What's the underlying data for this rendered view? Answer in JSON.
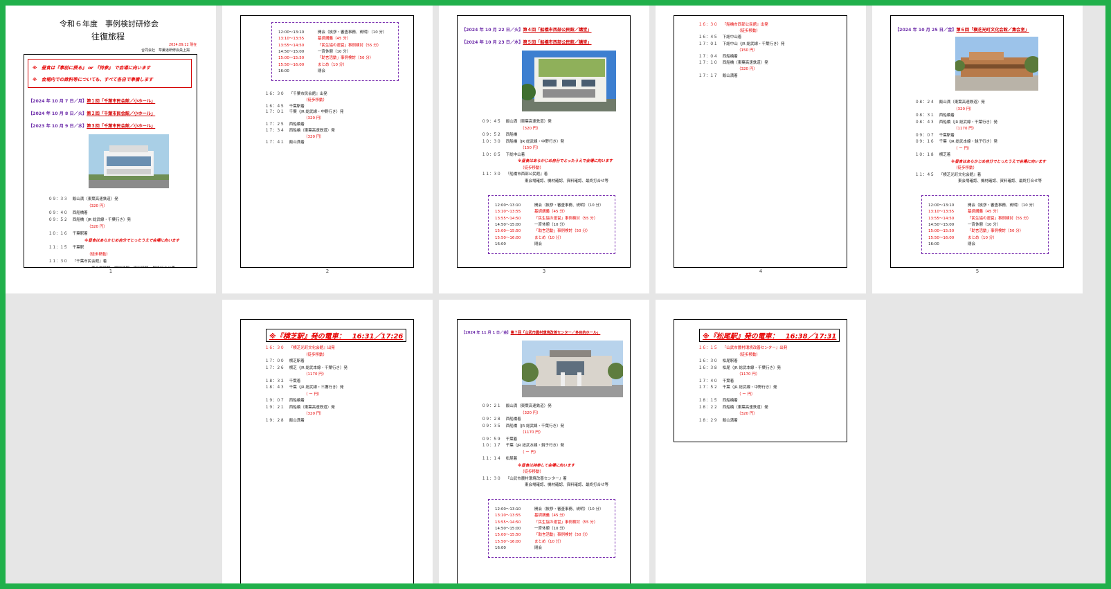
{
  "page1": {
    "title": "令和６年度　事例検討研修会",
    "subtitle": "往復旅程",
    "date": "2024.09.12 現在",
    "org": "合同会社　草薫道研修会員上掲",
    "notes": [
      "※　昼食は『事前に摂る』 or 『持参』 で会場に向います",
      "※　会場内での飲料等についても、すべて各自で準備します"
    ],
    "events": [
      {
        "date": "【2024 年 10 月  7 日／月】",
        "name": "第１回「千葉市民会館／小ホール」"
      },
      {
        "date": "【2024 年 10 月  8 日／火】",
        "name": "第２回「千葉市民会館／小ホール」"
      },
      {
        "date": "【2023 年 10 月  9 日／水】",
        "name": "第３回「千葉市民会館／小ホール」"
      }
    ],
    "lines": [
      {
        "t": "０９：３３　 飯山満（東葉高速鉄道）発",
        "red": false
      },
      {
        "t": "（320 円）",
        "red": true
      },
      {
        "t": "０９：４０　 西船橋着",
        "red": false
      },
      {
        "t": "０９：５２　 西船橋（JR 総武線・千葉行き）発",
        "red": false
      },
      {
        "t": "（320 円）",
        "red": true
      },
      {
        "t": "１０：１６　 千葉駅着",
        "red": false
      },
      {
        "t": "※昼食はあらかじめ自分でとったうえで会場に向います",
        "red": true
      },
      {
        "t": "１１：１５　 千葉駅",
        "red": false
      },
      {
        "t": "（徒歩移動）",
        "red": true
      },
      {
        "t": "１１：３０　 『千葉市民会館』着",
        "red": false
      },
      {
        "t": "東会場確認、機材確認、資料確認、最終打合せ等",
        "red": false
      }
    ],
    "num": "1"
  },
  "schedule": [
    {
      "time": "12:00〜13:10",
      "text": "開会（挨拶・審査事務、説明）（10 分）",
      "red": false
    },
    {
      "time": "13:10〜13:55",
      "text": "基調講義（45 分）",
      "red": true
    },
    {
      "time": "13:55〜14:50",
      "text": "「民生協の運営」事例検討（55 分）",
      "red": true
    },
    {
      "time": "14:50〜15:00",
      "text": "一斉休憩（10 分）",
      "red": false
    },
    {
      "time": "15:00〜15:50",
      "text": "「助言活動」事例検討（50 分）",
      "red": true
    },
    {
      "time": "15:50〜16:00",
      "text": "まとめ（10 分）",
      "red": true
    },
    {
      "time": "16:00",
      "text": "閉会",
      "red": false
    }
  ],
  "page2": {
    "lines": [
      {
        "t": "１６：３０　 『千葉市民会館』出発",
        "red": false
      },
      {
        "t": "（徒歩移動）",
        "red": true
      },
      {
        "t": "１６：４５　 千葉駅着",
        "red": false
      },
      {
        "t": "１７：０１　 千葉（JR 総武線・中野行き）発",
        "red": false
      },
      {
        "t": "（320 円）",
        "red": true
      },
      {
        "t": "１７：２５　 西船橋着",
        "red": false
      },
      {
        "t": "１７：３４　 西船橋（東葉高速鉄道）発",
        "red": false
      },
      {
        "t": "（320 円）",
        "red": true
      },
      {
        "t": "１７：４１　 飯山満着",
        "red": false
      }
    ],
    "num": "2"
  },
  "page3": {
    "events": [
      {
        "date": "【2024 年 10 月 22 日／火】",
        "name": "第４回「船橋市西部公民館／講堂」"
      },
      {
        "date": "【2024 年 10 月 23 日／水】",
        "name": "第５回「船橋市西部公民館／講堂」"
      }
    ],
    "lines": [
      {
        "t": "０９：４５　 飯山満（東葉高速鉄道）発",
        "red": false
      },
      {
        "t": "（320 円）",
        "red": true
      },
      {
        "t": "０９：５２　 西船橋",
        "red": false
      },
      {
        "t": "１０：３０　 西船橋（JR 総武線・中野行き）発",
        "red": false
      },
      {
        "t": "（150 円）",
        "red": true
      },
      {
        "t": "１０：０５　 下総中山着",
        "red": false
      },
      {
        "t": "※昼食はあらかじめ自分でとったうえで会場に向います",
        "red": true
      },
      {
        "t": "（徒歩移動）",
        "red": true
      },
      {
        "t": "１１：３０　 『船橋市西部公民館』着",
        "red": false
      },
      {
        "t": "東会場確認、機材確認、資料確認、最終打合せ等",
        "red": false
      }
    ],
    "num": "3"
  },
  "page4": {
    "lines": [
      {
        "t": "１６：３０　 『船橋市西部公民館』出発",
        "red": true
      },
      {
        "t": "（徒歩移動）",
        "red": true
      },
      {
        "t": "１６：４５　 下総中山着",
        "red": false
      },
      {
        "t": "１７：０１　 下総中山（JR 総武線・千葉行き）発",
        "red": false
      },
      {
        "t": "（150 円）",
        "red": true
      },
      {
        "t": "１７：０４　 西船橋着",
        "red": false
      },
      {
        "t": "１７：１０　 西船橋（東葉高速鉄道）発",
        "red": false
      },
      {
        "t": "（320 円）",
        "red": true
      },
      {
        "t": "１７：１７　 飯山満着",
        "red": false
      }
    ],
    "num": "4"
  },
  "page5": {
    "event": {
      "date": "【2024 年 10 月 25 日／金】",
      "name": "第６回「横芝光町文化会館／集会室」"
    },
    "lines": [
      {
        "t": "０８：２４　 飯山満（東葉高速鉄道）発",
        "red": false
      },
      {
        "t": "（320 円）",
        "red": true
      },
      {
        "t": "０８：３１　 西船橋着",
        "red": false
      },
      {
        "t": "０８：４３　 西船橋（JR 総武線・千葉行き）発",
        "red": false
      },
      {
        "t": "（1170 円）",
        "red": true
      },
      {
        "t": "０９：０７　 千葉駅着",
        "red": false
      },
      {
        "t": "０９：１６　 千葉（JR 総武本線・銚子行き）発",
        "red": false
      },
      {
        "t": "（ ー 円）",
        "red": true
      },
      {
        "t": "１０：１８　 横芝着",
        "red": false
      },
      {
        "t": "※昼食はあらかじめ自分でとったうえで会場に向います",
        "red": true
      },
      {
        "t": "（徒歩移動）",
        "red": true
      },
      {
        "t": "１１：４５　 『横芝光町文化会館』着",
        "red": false
      },
      {
        "t": "東会場確認、機材確認、資料確認、最終打合せ等",
        "red": false
      }
    ],
    "num": "5"
  },
  "page6": {
    "title": "※『横芝駅』発の電車：　16:31／17:26",
    "lines": [
      {
        "t": "１６：３０　 『横芝光町文化会館』出発",
        "red": true
      },
      {
        "t": "（徒歩移動）",
        "red": true
      },
      {
        "t": "１７：００　 横芝駅着",
        "red": false
      },
      {
        "t": "１７：２６　 横芝（JR 総武本線・千葉行き）発",
        "red": false
      },
      {
        "t": "（1170 円）",
        "red": true
      },
      {
        "t": "１８：３２　 千葉着",
        "red": false
      },
      {
        "t": "１８：４３　 千葉（JR 総武線・三鷹行き）発",
        "red": false
      },
      {
        "t": "（ ー 円）",
        "red": true
      },
      {
        "t": "１９：０７　 西船橋着",
        "red": false
      },
      {
        "t": "１９：２１　 西船橋（東葉高速鉄道）発",
        "red": false
      },
      {
        "t": "（320 円）",
        "red": true
      },
      {
        "t": "１９：２８　 飯山満着",
        "red": false
      }
    ]
  },
  "page7": {
    "event": {
      "date": "【2024 年 11 月  1 日／金】",
      "name": "第７回「山武市農村環境改善センター／多目的ホール」"
    },
    "lines": [
      {
        "t": "０９：２１　 飯山満（東葉高速鉄道）発",
        "red": false
      },
      {
        "t": "（320 円）",
        "red": true
      },
      {
        "t": "０９：２８　 西船橋着",
        "red": false
      },
      {
        "t": "０９：３５　 西船橋（JR 総武線・千葉行き）発",
        "red": false
      },
      {
        "t": "（1170 円）",
        "red": true
      },
      {
        "t": "０９：５９　 千葉着",
        "red": false
      },
      {
        "t": "１０：１７　 千葉（JR 総武本線・銚子行き）発",
        "red": false
      },
      {
        "t": "（ ー 円）",
        "red": true
      },
      {
        "t": "１１：１４　 松尾着",
        "red": false
      },
      {
        "t": "※昼食は持参して会場に向います",
        "red": true
      },
      {
        "t": "（徒歩移動）",
        "red": true
      },
      {
        "t": "１１：３０　 『山武市農村環境改善センター』着",
        "red": false
      },
      {
        "t": "東会場確認、機材確認、資料確認、最終打合せ等",
        "red": false
      }
    ]
  },
  "page8": {
    "title": "※『松尾駅』発の電車：　16:38／17:31",
    "lines": [
      {
        "t": "１６：１５　 『山武市農村環境改善センター』出発",
        "red": true
      },
      {
        "t": "（徒歩移動）",
        "red": true
      },
      {
        "t": "１６：３０　 松尾駅着",
        "red": false
      },
      {
        "t": "１６：３８　 松尾（JR 総武本線・千葉行き）発",
        "red": false
      },
      {
        "t": "（1170 円）",
        "red": true
      },
      {
        "t": "１７：４０　 千葉着",
        "red": false
      },
      {
        "t": "１７：５２　 千葉（JR 総武線・中野行き）発",
        "red": false
      },
      {
        "t": "（ ー 円）",
        "red": true
      },
      {
        "t": "１８：１５　 西船橋着",
        "red": false
      },
      {
        "t": "１８：２２　 西船橋（東葉高速鉄道）発",
        "red": false
      },
      {
        "t": "（320 円）",
        "red": true
      },
      {
        "t": "１８：２９　 飯山満着",
        "red": false
      }
    ]
  }
}
